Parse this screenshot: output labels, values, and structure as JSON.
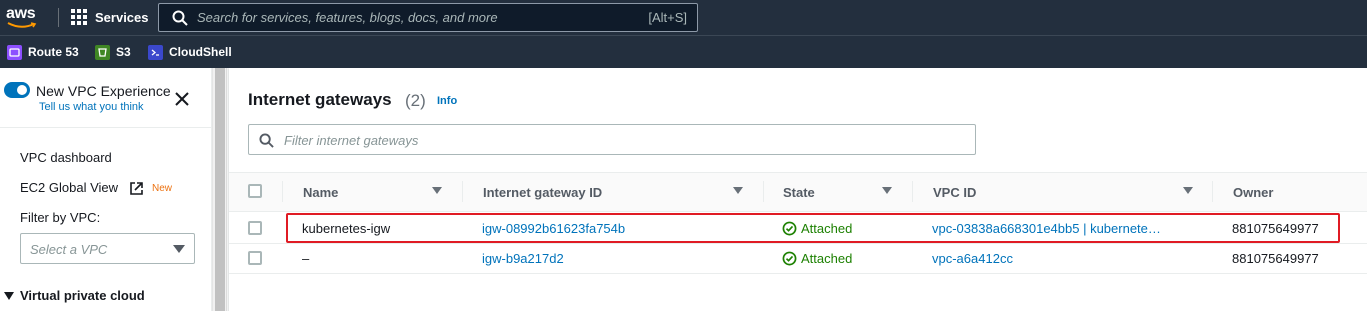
{
  "topnav": {
    "logo": "aws",
    "services_label": "Services",
    "search_placeholder": "Search for services, features, blogs, docs, and more",
    "search_shortcut": "[Alt+S]"
  },
  "favorites": [
    {
      "label": "Route 53",
      "icon": "route53-icon",
      "color": "#8c4fff"
    },
    {
      "label": "S3",
      "icon": "s3-icon",
      "color": "#3f8624"
    },
    {
      "label": "CloudShell",
      "icon": "cloudshell-icon",
      "color": "#3b48cc"
    }
  ],
  "sidebar": {
    "toggle_label": "New VPC Experience",
    "toggle_on": true,
    "feedback_link": "Tell us what you think",
    "links": [
      "VPC dashboard",
      "EC2 Global View"
    ],
    "new_badge": "New",
    "filter_label": "Filter by VPC:",
    "filter_placeholder": "Select a VPC",
    "section": "Virtual private cloud"
  },
  "main": {
    "title": "Internet gateways",
    "count": "(2)",
    "info": "Info",
    "filter_placeholder": "Filter internet gateways",
    "columns": [
      "Name",
      "Internet gateway ID",
      "State",
      "VPC ID",
      "Owner"
    ],
    "rows": [
      {
        "name": "kubernetes-igw",
        "igw_id": "igw-08992b61623fa754b",
        "state": "Attached",
        "vpc_id": "vpc-03838a668301e4bb5 | kubernete…",
        "owner": "881075649977",
        "highlighted": true
      },
      {
        "name": "–",
        "igw_id": "igw-b9a217d2",
        "state": "Attached",
        "vpc_id": "vpc-a6a412cc",
        "owner": "881075649977",
        "highlighted": false
      }
    ]
  },
  "colors": {
    "nav_bg": "#232f3e",
    "link": "#0073bb",
    "success": "#1d8102",
    "highlight": "#e01b24",
    "badge_new": "#ec7211"
  }
}
